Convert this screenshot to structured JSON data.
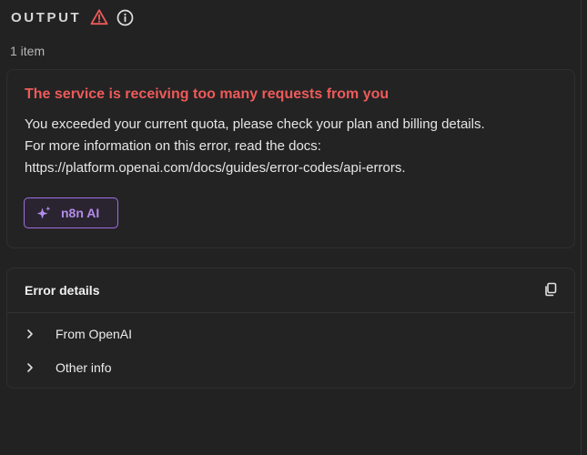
{
  "header": {
    "title": "OUTPUT",
    "icons": {
      "warning": "warning-triangle-icon",
      "info": "info-circle-icon"
    }
  },
  "item_count": "1 item",
  "error": {
    "title": "The service is receiving too many requests from you",
    "message_lines": [
      "You exceeded your current quota, please check your plan and billing details.",
      "For more information on this error, read the docs:",
      "https://platform.openai.com/docs/guides/error-codes/api-errors."
    ],
    "ai_button_label": "n8n AI"
  },
  "details": {
    "title": "Error details",
    "rows": [
      {
        "label": "From OpenAI"
      },
      {
        "label": "Other info"
      }
    ]
  },
  "colors": {
    "error_red": "#ef5a5a",
    "ai_purple": "#b28ce8",
    "background": "#222222"
  }
}
